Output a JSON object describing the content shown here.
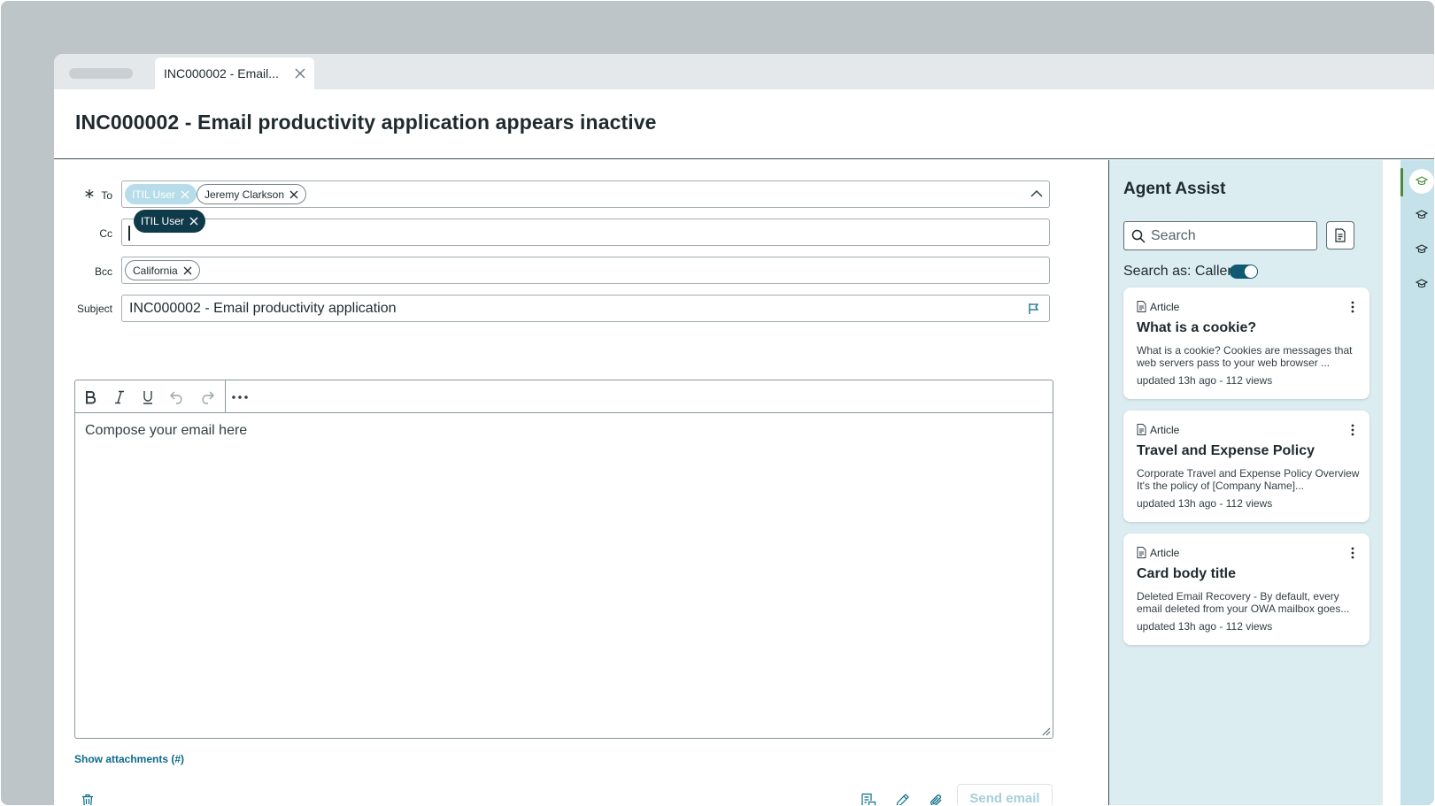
{
  "tab": {
    "label": "INC000002 - Email..."
  },
  "page": {
    "title": "INC000002 - Email productivity application appears inactive"
  },
  "compose": {
    "to_label": "To",
    "to_chips": [
      "ITIL User",
      "Jeremy Clarkson"
    ],
    "cc_label": "Cc",
    "drag_chip": "ITIL User",
    "bcc_label": "Bcc",
    "bcc_chips": [
      "California"
    ],
    "subject_label": "Subject",
    "subject_value": "INC000002 - Email productivity application",
    "body_placeholder": "Compose your email here",
    "show_attachments": "Show attachments (#)",
    "send_label": "Send email"
  },
  "assist": {
    "title": "Agent Assist",
    "search_placeholder": "Search",
    "search_as": "Search as: Caller",
    "search_as_enabled": true,
    "cards": [
      {
        "type": "Article",
        "title": "What is a cookie?",
        "body": "What is a cookie? Cookies are messages that web servers pass to your web browser ...",
        "meta": "updated 13h ago - 112 views"
      },
      {
        "type": "Article",
        "title": "Travel and Expense Policy",
        "body": "Corporate Travel and Expense Policy Overview It's the policy of [Company Name]...",
        "meta": "updated 13h ago - 112 views"
      },
      {
        "type": "Article",
        "title": "Card body title",
        "body": "Deleted Email Recovery - By default, every email deleted from your OWA mailbox goes...",
        "meta": "updated 13h ago - 112 views"
      }
    ]
  },
  "colors": {
    "accent": "#0f3a4a",
    "link": "#0b6b8a",
    "assist_bg": "#dcedf2",
    "rail_bg": "#c5e1ea"
  }
}
